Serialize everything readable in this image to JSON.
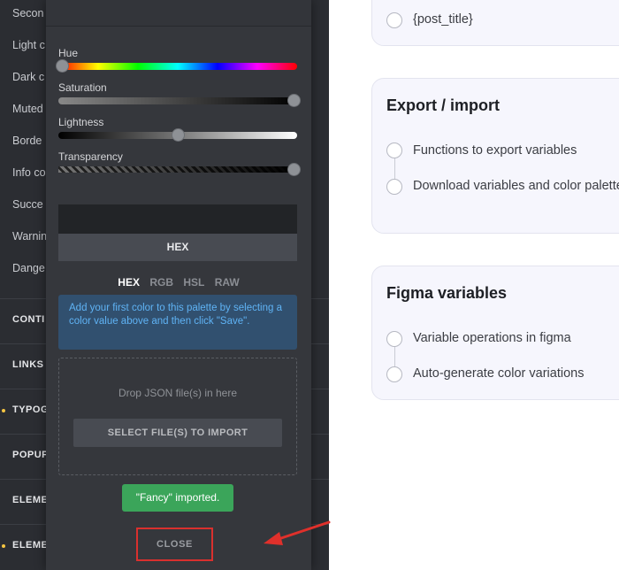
{
  "sidebar": {
    "colors": [
      "Secon",
      "Light c",
      "Dark c",
      "Muted",
      "Borde",
      "Info co",
      "Succe",
      "Warnin",
      "Dange"
    ],
    "categories": [
      {
        "label": "CONTI",
        "dot": false
      },
      {
        "label": "LINKS",
        "dot": false
      },
      {
        "label": "TYPOG",
        "dot": true
      },
      {
        "label": "POPUP",
        "dot": false
      },
      {
        "label": "ELEME",
        "dot": false
      },
      {
        "label": "ELEME",
        "dot": true
      }
    ]
  },
  "picker": {
    "hue_label": "Hue",
    "saturation_label": "Saturation",
    "lightness_label": "Lightness",
    "transparency_label": "Transparency",
    "hue_value": 0.0,
    "saturation_value": 1.0,
    "lightness_value": 0.5,
    "transparency_value": 1.0,
    "format_button": "HEX",
    "format_tabs": [
      "HEX",
      "RGB",
      "HSL",
      "RAW"
    ],
    "active_format": "HEX",
    "info_text": "Add your first color to this palette by selecting a color value above and then click \"Save\".",
    "drop_text": "Drop JSON file(s) in here",
    "select_files_label": "SELECT FILE(S) TO IMPORT",
    "toast_text": "\"Fancy\" imported.",
    "close_label": "CLOSE"
  },
  "content": {
    "top_item": "{post_title}",
    "export_card": {
      "title": "Export / import",
      "items": [
        "Functions to export variables",
        "Download variables and color palette"
      ]
    },
    "figma_card": {
      "title": "Figma variables",
      "items": [
        "Variable operations in figma",
        "Auto-generate color variations"
      ]
    }
  },
  "colors": {
    "sidebar_bg": "#2b2d32",
    "picker_bg": "#35373c",
    "info_bg": "#31506f",
    "info_text": "#5fb3f5",
    "toast_bg": "#3ba55a",
    "highlight_red": "#d9302e",
    "card_bg": "#f6f6fd"
  }
}
